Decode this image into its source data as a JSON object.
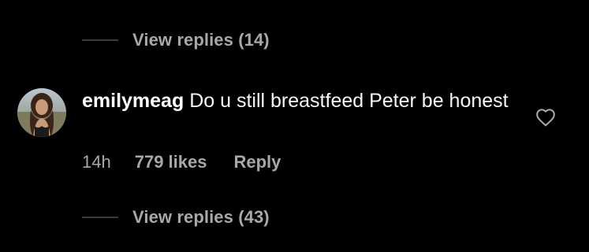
{
  "top_replies": {
    "label": "View replies (14)"
  },
  "comment": {
    "username": "emilymeag",
    "text": "Do u still breastfeed Peter be honest",
    "time": "14h",
    "likes": "779 likes",
    "reply_label": "Reply",
    "like_icon": "heart-outline-icon"
  },
  "bottom_replies": {
    "label": "View replies (43)"
  },
  "colors": {
    "background": "#000000",
    "primary_text": "#ffffff",
    "secondary_text": "#a8a8a8",
    "divider": "#3a3a3a"
  }
}
